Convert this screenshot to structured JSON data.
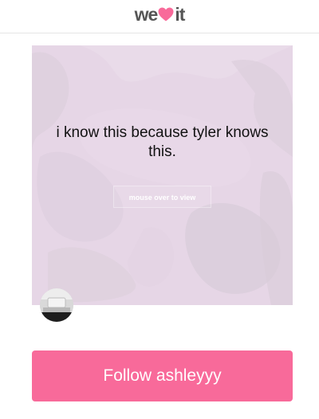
{
  "header": {
    "logo_left": "we",
    "logo_right": "it"
  },
  "post": {
    "text": "i know this because tyler knows this.",
    "mouse_over_label": "mouse over to view"
  },
  "follow_button": {
    "label": "Follow ashleyyy"
  },
  "colors": {
    "brand_pink": "#f86a9a",
    "card_bg": "#e6d6e6"
  }
}
